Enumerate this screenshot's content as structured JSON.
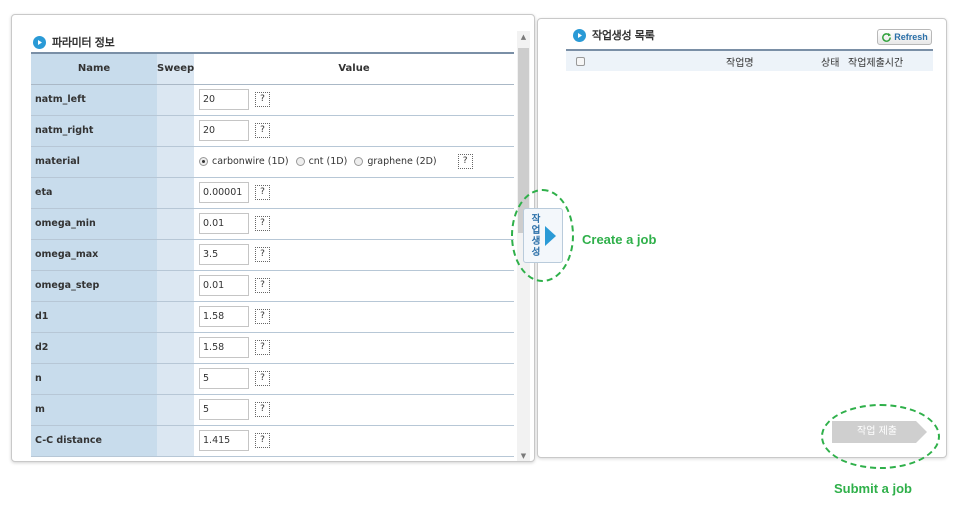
{
  "left_panel": {
    "title": "파라미터 정보",
    "columns": {
      "name": "Name",
      "sweep": "Sweep",
      "value": "Value"
    },
    "help_label": "?",
    "params": [
      {
        "name": "natm_left",
        "value": "20"
      },
      {
        "name": "natm_right",
        "value": "20"
      },
      {
        "name": "material",
        "type": "radio",
        "options": [
          "carbonwire (1D)",
          "cnt (1D)",
          "graphene (2D)"
        ],
        "selected": "carbonwire (1D)"
      },
      {
        "name": "eta",
        "value": "0.00001"
      },
      {
        "name": "omega_min",
        "value": "0.01"
      },
      {
        "name": "omega_max",
        "value": "3.5"
      },
      {
        "name": "omega_step",
        "value": "0.01"
      },
      {
        "name": "d1",
        "value": "1.58"
      },
      {
        "name": "d2",
        "value": "1.58"
      },
      {
        "name": "n",
        "value": "5"
      },
      {
        "name": "m",
        "value": "5"
      },
      {
        "name": "C-C distance",
        "value": "1.415"
      }
    ]
  },
  "create_job": {
    "button_label": "작업생성",
    "annotation": "Create a job"
  },
  "right_panel": {
    "title": "작업생성 목록",
    "refresh_label": "Refresh",
    "columns": {
      "name": "작업명",
      "status": "상태",
      "submit_time": "작업제출시간"
    },
    "submit_label": "작업 제출",
    "submit_annotation": "Submit a job"
  },
  "colors": {
    "accent_blue": "#2a9ad6",
    "annotation_green": "#2fb04a",
    "name_column_bg": "#c8dcec",
    "submit_disabled": "#cfcfcf"
  },
  "icons": {
    "panel_title": "circle-play-icon",
    "refresh": "refresh-icon",
    "create": "arrow-right-icon"
  }
}
